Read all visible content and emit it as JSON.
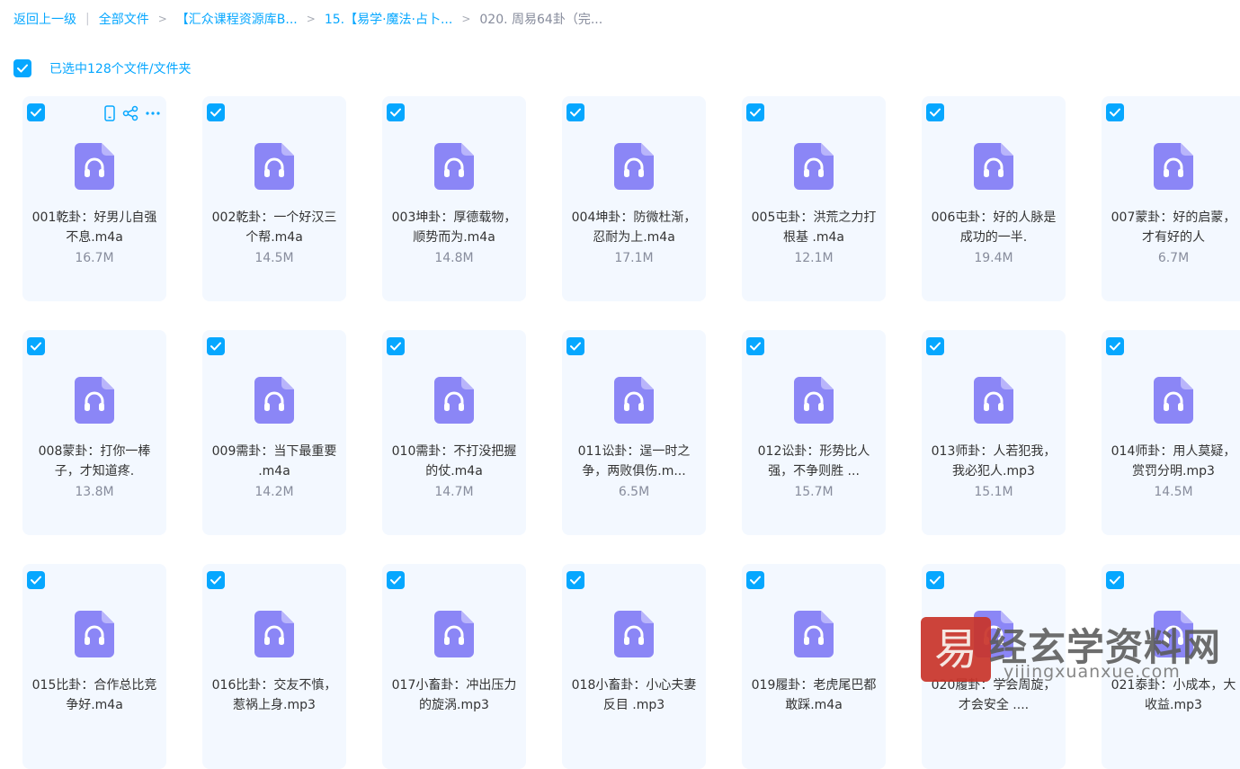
{
  "breadcrumb": {
    "back": "返回上一级",
    "items": [
      "全部文件",
      "【汇众课程资源库B...",
      "15.【易学·魔法·占卜...",
      "020. 周易64卦（完..."
    ]
  },
  "selection": {
    "text": "已选中128个文件/文件夹",
    "checked": true
  },
  "colors": {
    "accent": "#06a7ff",
    "card_bg": "#f3f8ff",
    "icon": "#8b86f6",
    "muted": "#878c9c"
  },
  "files": [
    {
      "name": "001乾卦：好男儿自强不息.m4a",
      "size": "16.7M",
      "icon": "audio-file-icon"
    },
    {
      "name": "002乾卦：一个好汉三个帮.m4a",
      "size": "14.5M",
      "icon": "audio-file-icon"
    },
    {
      "name": "003坤卦：厚德载物，顺势而为.m4a",
      "size": "14.8M",
      "icon": "audio-file-icon"
    },
    {
      "name": "004坤卦：防微杜渐，忍耐为上.m4a",
      "size": "17.1M",
      "icon": "audio-file-icon"
    },
    {
      "name": "005屯卦：洪荒之力打根基 .m4a",
      "size": "12.1M",
      "icon": "audio-file-icon"
    },
    {
      "name": "006屯卦：好的人脉是成功的一半.",
      "size": "19.4M",
      "icon": "audio-file-icon"
    },
    {
      "name": "007蒙卦：好的启蒙，才有好的人",
      "size": "6.7M",
      "icon": "audio-file-icon"
    },
    {
      "name": "008蒙卦：打你一棒子，才知道疼.",
      "size": "13.8M",
      "icon": "audio-file-icon"
    },
    {
      "name": "009需卦：当下最重要 .m4a",
      "size": "14.2M",
      "icon": "audio-file-icon"
    },
    {
      "name": "010需卦：不打没把握的仗.m4a",
      "size": "14.7M",
      "icon": "audio-file-icon"
    },
    {
      "name": "011讼卦：逞一时之争，两败俱伤.m...",
      "size": "6.5M",
      "icon": "audio-file-icon"
    },
    {
      "name": "012讼卦：形势比人强，不争则胜 ...",
      "size": "15.7M",
      "icon": "audio-file-icon"
    },
    {
      "name": "013师卦：人若犯我，我必犯人.mp3",
      "size": "15.1M",
      "icon": "audio-file-icon"
    },
    {
      "name": "014师卦：用人莫疑，赏罚分明.mp3",
      "size": "14.5M",
      "icon": "audio-file-icon"
    },
    {
      "name": "015比卦：合作总比竞争好.m4a",
      "size": "",
      "icon": "audio-file-icon"
    },
    {
      "name": "016比卦：交友不慎，惹祸上身.mp3",
      "size": "",
      "icon": "audio-file-icon"
    },
    {
      "name": "017小畜卦：冲出压力的旋涡.mp3",
      "size": "",
      "icon": "audio-file-icon"
    },
    {
      "name": "018小畜卦：小心夫妻反目 .mp3",
      "size": "",
      "icon": "audio-file-icon"
    },
    {
      "name": "019履卦：老虎尾巴都敢踩.m4a",
      "size": "",
      "icon": "audio-file-icon"
    },
    {
      "name": "020履卦：学会周旋，才会安全 ....",
      "size": "",
      "icon": "audio-file-icon"
    },
    {
      "name": "021泰卦：小成本，大收益.mp3",
      "size": "",
      "icon": "audio-file-icon"
    }
  ],
  "card_actions": [
    "phone-icon",
    "share-icon",
    "more-icon"
  ],
  "watermark": {
    "brand": "经玄学资料网",
    "url": "yijingxuanxue.com",
    "seal": "易"
  }
}
